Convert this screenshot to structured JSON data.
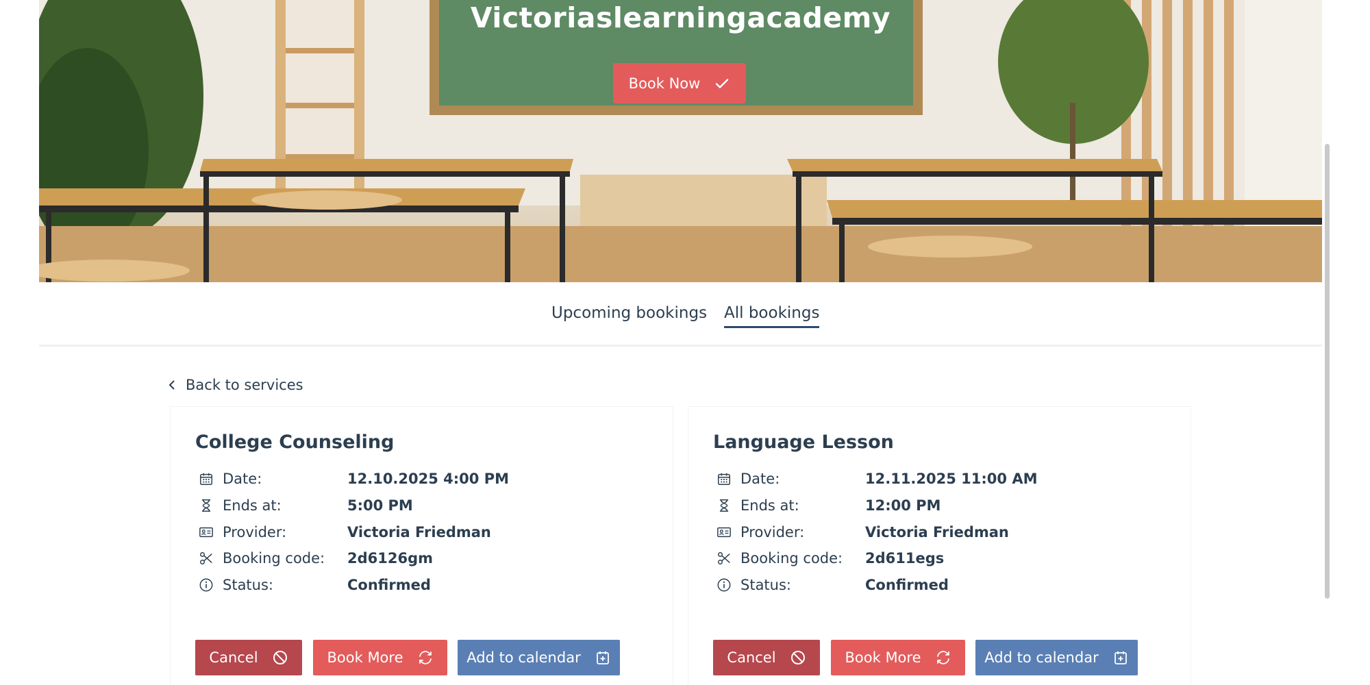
{
  "hero": {
    "title": "Victoriaslearningacademy",
    "book_now_label": "Book Now"
  },
  "tabs": [
    {
      "label": "Upcoming bookings",
      "active": false
    },
    {
      "label": "All bookings",
      "active": true
    }
  ],
  "back_link": "Back to services",
  "bookings": [
    {
      "title": "College Counseling",
      "fields": [
        {
          "icon": "calendar-icon",
          "label": "Date:",
          "value": "12.10.2025 4:00 PM"
        },
        {
          "icon": "hourglass-icon",
          "label": "Ends at:",
          "value": "5:00 PM"
        },
        {
          "icon": "id-card-icon",
          "label": "Provider:",
          "value": "Victoria Friedman"
        },
        {
          "icon": "scissors-icon",
          "label": "Booking code:",
          "value": "2d6126gm"
        },
        {
          "icon": "info-icon",
          "label": "Status:",
          "value": "Confirmed"
        }
      ],
      "buttons": {
        "cancel": "Cancel",
        "book_more": "Book More",
        "add_to_calendar": "Add to calendar"
      }
    },
    {
      "title": "Language Lesson",
      "fields": [
        {
          "icon": "calendar-icon",
          "label": "Date:",
          "value": "12.11.2025 11:00 AM"
        },
        {
          "icon": "hourglass-icon",
          "label": "Ends at:",
          "value": "12:00 PM"
        },
        {
          "icon": "id-card-icon",
          "label": "Provider:",
          "value": "Victoria Friedman"
        },
        {
          "icon": "scissors-icon",
          "label": "Booking code:",
          "value": "2d611egs"
        },
        {
          "icon": "info-icon",
          "label": "Status:",
          "value": "Confirmed"
        }
      ],
      "buttons": {
        "cancel": "Cancel",
        "book_more": "Book More",
        "add_to_calendar": "Add to calendar"
      }
    }
  ],
  "colors": {
    "primary_red": "#e35b5b",
    "cancel_red": "#b5474d",
    "calendar_blue": "#5a7fb4",
    "text_dark": "#2c3e50"
  }
}
